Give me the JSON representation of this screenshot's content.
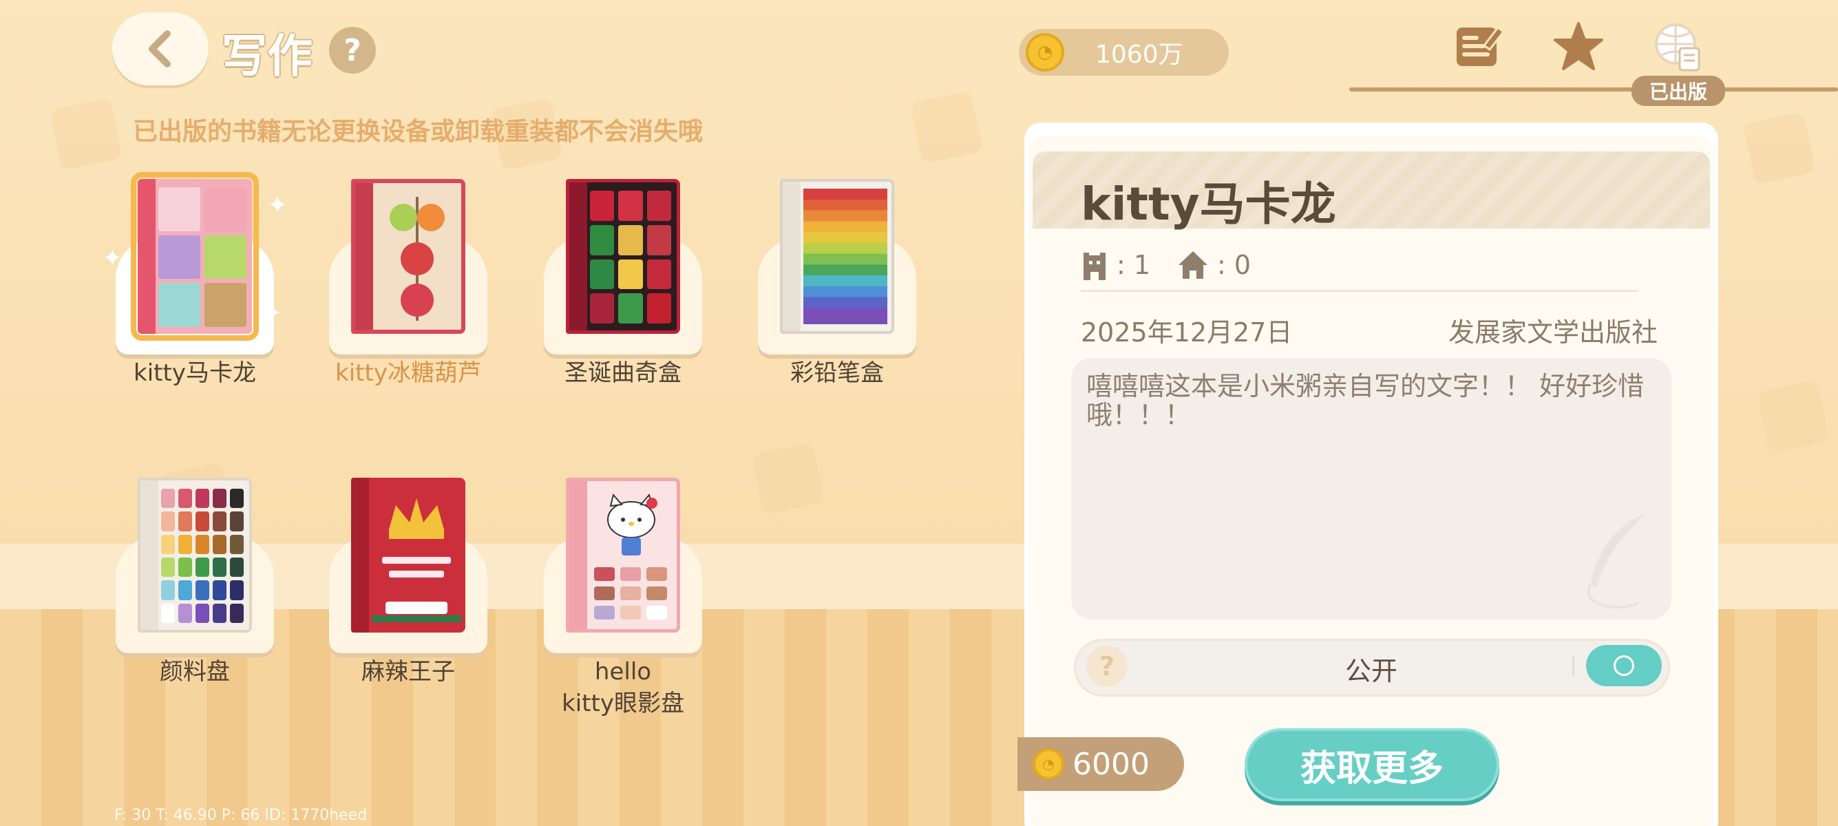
{
  "header": {
    "title": "写作",
    "help_label": "?",
    "coins": "1060万",
    "published_tag": "已出版",
    "icons": [
      "back-arrow-icon",
      "help-icon",
      "coin-icon",
      "write-icon",
      "star-icon",
      "published-books-icon"
    ]
  },
  "notice": "已出版的书籍无论更换设备或卸载重装都不会消失哦",
  "books": [
    {
      "label": "kitty马卡龙",
      "selected": true
    },
    {
      "label": "kitty冰糖葫芦",
      "highlighted": true
    },
    {
      "label": "圣诞曲奇盒"
    },
    {
      "label": "彩铅笔盒"
    },
    {
      "label": "颜料盘"
    },
    {
      "label": "麻辣王子"
    },
    {
      "label": "hello\nkitty眼影盘"
    }
  ],
  "detail": {
    "title": "kitty马卡龙",
    "stat_sep": ":",
    "readers": "1",
    "homes": "0",
    "date": "2025年12月27日",
    "publisher": "发展家文学出版社",
    "description": "嘻嘻嘻这本是小米粥亲自写的文字！！ 好好珍惜哦！！！",
    "visibility_label": "公开",
    "visibility_on": true,
    "help_label": "?",
    "price": "6000",
    "get_more_label": "获取更多"
  },
  "debug": "F: 30    T: 46.90    P: 66    ID: 1770heed",
  "colors": {
    "accent": "#66cec5",
    "coin": "#f5c232",
    "title_text": "#5b4a3a",
    "notice": "#e5ad6c"
  }
}
